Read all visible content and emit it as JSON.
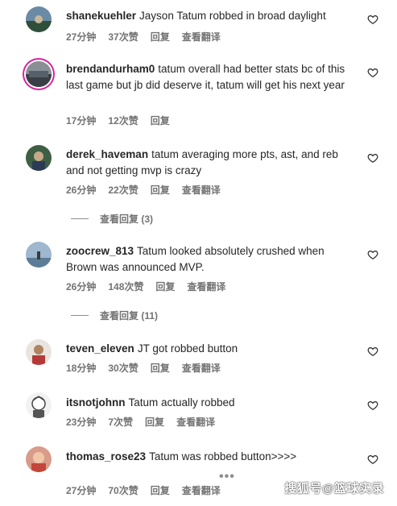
{
  "comments": [
    {
      "username": "shanekuehler",
      "text": "Jayson Tatum robbed in broad daylight",
      "time": "27分钟",
      "likes": "37次赞",
      "reply": "回复",
      "translate": "查看翻译"
    },
    {
      "username": "brendandurham0",
      "text": "tatum overall had better stats bc of this last game but jb did deserve it, tatum will get his next year",
      "time": "17分钟",
      "likes": "12次赞",
      "reply": "回复",
      "translate": ""
    },
    {
      "username": "derek_haveman",
      "text": "tatum averaging more pts, ast, and reb and not getting mvp is crazy",
      "time": "26分钟",
      "likes": "22次赞",
      "reply": "回复",
      "translate": "查看翻译",
      "view_replies": "查看回复 (3)"
    },
    {
      "username": "zoocrew_813",
      "text": "Tatum looked absolutely crushed when Brown was announced MVP.",
      "time": "26分钟",
      "likes": "148次赞",
      "reply": "回复",
      "translate": "查看翻译",
      "view_replies": "查看回复 (11)"
    },
    {
      "username": "teven_eleven",
      "text": "JT got robbed button",
      "time": "18分钟",
      "likes": "30次赞",
      "reply": "回复",
      "translate": "查看翻译"
    },
    {
      "username": "itsnotjohnn",
      "text": "Tatum actually robbed",
      "time": "23分钟",
      "likes": "7次赞",
      "reply": "回复",
      "translate": "查看翻译"
    },
    {
      "username": "thomas_rose23",
      "text": "Tatum was robbed button>>>>",
      "time": "27分钟",
      "likes": "70次赞",
      "reply": "回复",
      "translate": "查看翻译"
    }
  ],
  "more_indicator": "•••",
  "watermark": "搜狐号@篮球实录",
  "icons": {
    "like": "heart-outline-icon",
    "more": "more-dots-icon"
  },
  "colors": {
    "text": "#262626",
    "secondary": "#737373",
    "story_ring": "#d6249f"
  }
}
